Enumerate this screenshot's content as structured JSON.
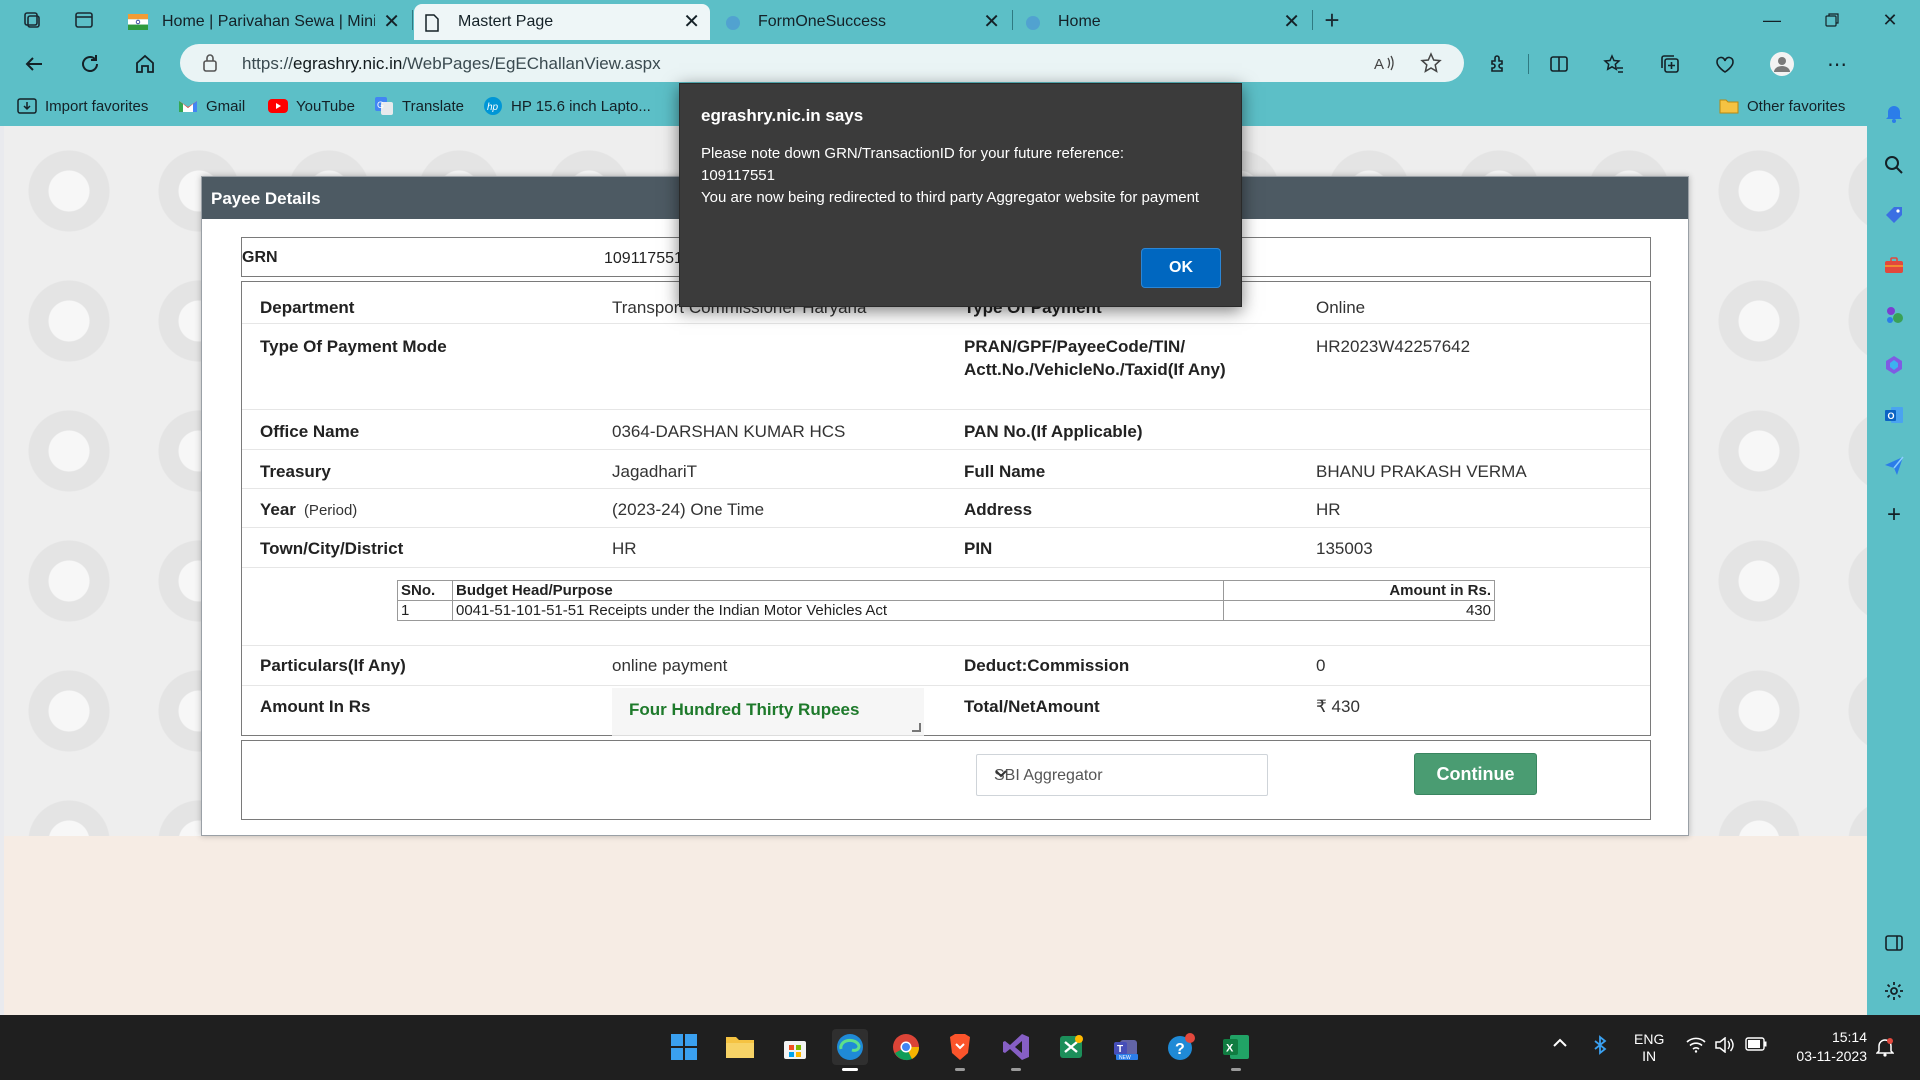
{
  "browser": {
    "tabs": [
      {
        "label": "Home | Parivahan Sewa | Ministr",
        "active": false
      },
      {
        "label": "Mastert Page",
        "active": true
      },
      {
        "label": "FormOneSuccess",
        "active": false
      },
      {
        "label": "Home",
        "active": false
      }
    ],
    "address_bar": {
      "url_prefix": "https://",
      "url_host": "egrashry.nic.in",
      "url_path": "/WebPages/EgEChallanView.aspx"
    },
    "favorites": [
      "Import favorites",
      "Gmail",
      "YouTube",
      "Translate",
      "HP 15.6 inch Lapto...",
      "Other favorites"
    ]
  },
  "panel": {
    "title": "Payee Details",
    "grn": {
      "label": "GRN",
      "value": "109117551"
    },
    "rows": {
      "department": {
        "label": "Department",
        "value": "Transport Commissioner Haryana"
      },
      "type_of_payment": {
        "label": "Type Of Payment",
        "value": "Online"
      },
      "payment_mode": {
        "label": "Type Of Payment Mode",
        "value": ""
      },
      "pran": {
        "label": "PRAN/GPF/PayeeCode/TIN/ Actt.No./VehicleNo./Taxid(If Any)",
        "value": "HR2023W42257642"
      },
      "office_name": {
        "label": "Office Name",
        "value": "0364-DARSHAN KUMAR HCS"
      },
      "pan": {
        "label": "PAN No.(If Applicable)",
        "value": ""
      },
      "treasury": {
        "label": "Treasury",
        "value": "JagadhariT"
      },
      "full_name": {
        "label": "Full Name",
        "value": "BHANU PRAKASH VERMA"
      },
      "year": {
        "label": "Year",
        "sublabel": "(Period)",
        "value": "(2023-24) One Time"
      },
      "address": {
        "label": "Address",
        "value": "HR"
      },
      "town": {
        "label": "Town/City/District",
        "value": "HR"
      },
      "pin": {
        "label": "PIN",
        "value": "135003"
      },
      "particulars": {
        "label": "Particulars(If Any)",
        "value": "online payment"
      },
      "deduct": {
        "label": "Deduct:Commission",
        "value": "0"
      },
      "amount_in_rs": {
        "label": "Amount In Rs",
        "value": "Four Hundred Thirty Rupees"
      },
      "total": {
        "label": "Total/NetAmount",
        "value": "₹ 430"
      }
    },
    "budget_table": {
      "headers": [
        "SNo.",
        "Budget Head/Purpose",
        "Amount in Rs."
      ],
      "rows": [
        [
          "1",
          "0041-51-101-51-51 Receipts under the Indian Motor Vehicles Act",
          "430"
        ]
      ]
    },
    "aggregator_select": {
      "selected": "SBI Aggregator"
    },
    "continue_label": "Continue"
  },
  "dialog": {
    "title": "egrashry.nic.in says",
    "line1": "Please note down GRN/TransactionID for your future reference:",
    "line2": "109117551",
    "line3": "You are now being redirected to  third party Aggregator website for payment",
    "ok_label": "OK"
  },
  "taskbar": {
    "language": "ENG",
    "region": "IN",
    "time": "15:14",
    "date": "03-11-2023"
  },
  "colors": {
    "chrome": "#5cbfc7",
    "panel_header": "#4d5a63",
    "continue_button": "#4a9c72",
    "ok_button": "#0067c0",
    "amount_words": "#1e7a2b"
  }
}
